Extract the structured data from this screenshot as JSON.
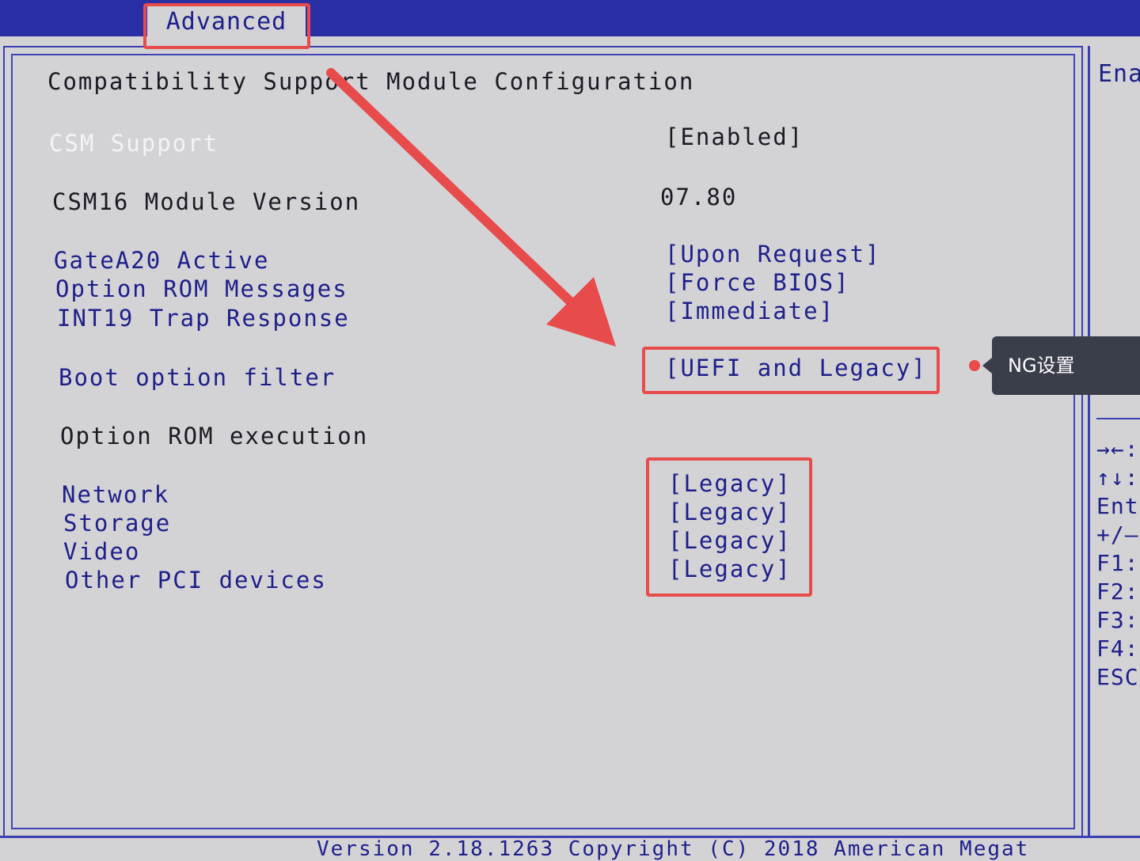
{
  "tab": {
    "label": "Advanced"
  },
  "page": {
    "title": "Compatibility Support Module Configuration"
  },
  "settings": [
    {
      "label": "CSM Support",
      "value": "[Enabled]"
    },
    {
      "label": "CSM16 Module Version",
      "value": "07.80"
    },
    {
      "label": "GateA20 Active",
      "value": "[Upon Request]"
    },
    {
      "label": "Option ROM Messages",
      "value": "[Force BIOS]"
    },
    {
      "label": "INT19 Trap Response",
      "value": "[Immediate]"
    },
    {
      "label": "Boot option filter",
      "value": "[UEFI and Legacy]"
    },
    {
      "label": "Option ROM execution",
      "value": ""
    },
    {
      "label": "Network",
      "value": "[Legacy]"
    },
    {
      "label": "Storage",
      "value": "[Legacy]"
    },
    {
      "label": "Video",
      "value": "[Legacy]"
    },
    {
      "label": "Other PCI devices",
      "value": "[Legacy]"
    }
  ],
  "help": {
    "header": "Ena",
    "keys": [
      "→←:",
      "↑↓:",
      "Ent",
      "+/–",
      "F1:",
      "F2:",
      "F3:",
      "F4:",
      "ESC"
    ]
  },
  "footer": {
    "text": "Version 2.18.1263  Copyright (C) 2018 American Megat"
  },
  "annotation": {
    "tooltip": "NG设置",
    "color": "#e84b4b"
  }
}
